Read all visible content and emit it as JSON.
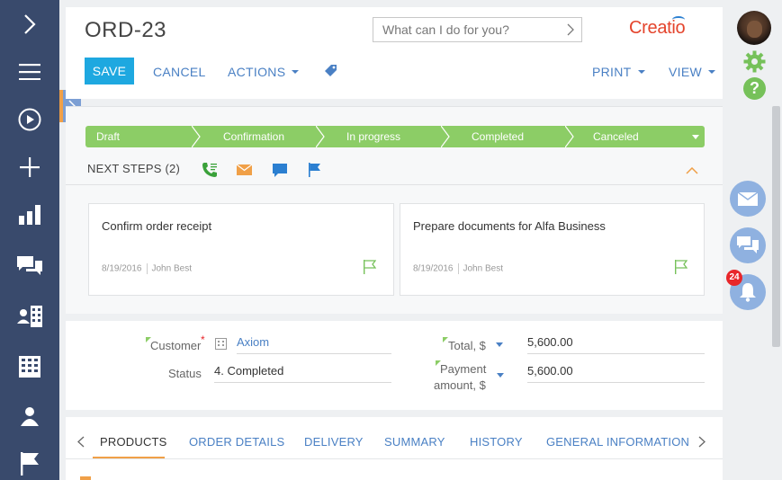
{
  "header": {
    "title": "ORD-23",
    "search_placeholder": "What can I do for you?",
    "logo_text": "Creatio"
  },
  "toolbar": {
    "save_label": "SAVE",
    "cancel_label": "CANCEL",
    "actions_label": "ACTIONS",
    "print_label": "PRINT",
    "view_label": "VIEW"
  },
  "leftnav": {
    "icons": [
      "chevron-right-icon",
      "hamburger-icon",
      "play-icon",
      "plus-icon",
      "bar-chart-icon",
      "chat-icon",
      "contacts-icon",
      "building-icon",
      "user-icon",
      "flag-icon"
    ]
  },
  "stages": [
    "Draft",
    "Confirmation",
    "In progress",
    "Completed",
    "Canceled"
  ],
  "next_steps": {
    "label": "NEXT STEPS (2)"
  },
  "tasks": [
    {
      "title": "Confirm order receipt",
      "date": "8/19/2016",
      "owner": "John Best"
    },
    {
      "title": "Prepare documents for Alfa Business",
      "date": "8/19/2016",
      "owner": "John Best"
    }
  ],
  "fields": {
    "customer_label": "Customer",
    "customer_value": "Axiom",
    "status_label": "Status",
    "status_value": "4. Completed",
    "total_label": "Total, $",
    "total_value": "5,600.00",
    "payment_label_1": "Payment",
    "payment_label_2": "amount, $",
    "payment_value": "5,600.00"
  },
  "tabs": [
    "PRODUCTS",
    "ORDER DETAILS",
    "DELIVERY",
    "SUMMARY",
    "HISTORY",
    "GENERAL INFORMATION"
  ],
  "notifications": {
    "count": "24"
  },
  "colors": {
    "nav_bg": "#394a6c",
    "accent_blue": "#1ea8e0",
    "stage_green": "#8ccd66",
    "link_blue": "#4a80c4",
    "orange": "#f0a048"
  }
}
